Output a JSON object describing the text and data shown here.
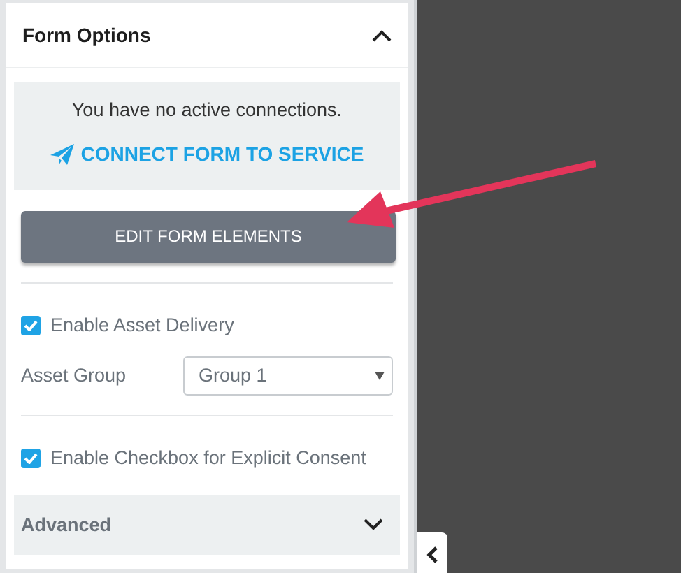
{
  "panel": {
    "title": "Form Options",
    "expanded": true
  },
  "connections": {
    "message": "You have no active connections.",
    "link": "CONNECT FORM TO SERVICE"
  },
  "edit_button": "EDIT FORM ELEMENTS",
  "options": [
    {
      "kind": "checkbox",
      "label": "Enable Asset Delivery",
      "checked": true
    },
    {
      "kind": "select",
      "label": "Asset Group",
      "value": "Group 1"
    },
    {
      "kind": "checkbox",
      "label": "Enable Checkbox for Explicit Consent",
      "checked": true
    }
  ],
  "advanced": {
    "title": "Advanced",
    "expanded": false
  }
}
